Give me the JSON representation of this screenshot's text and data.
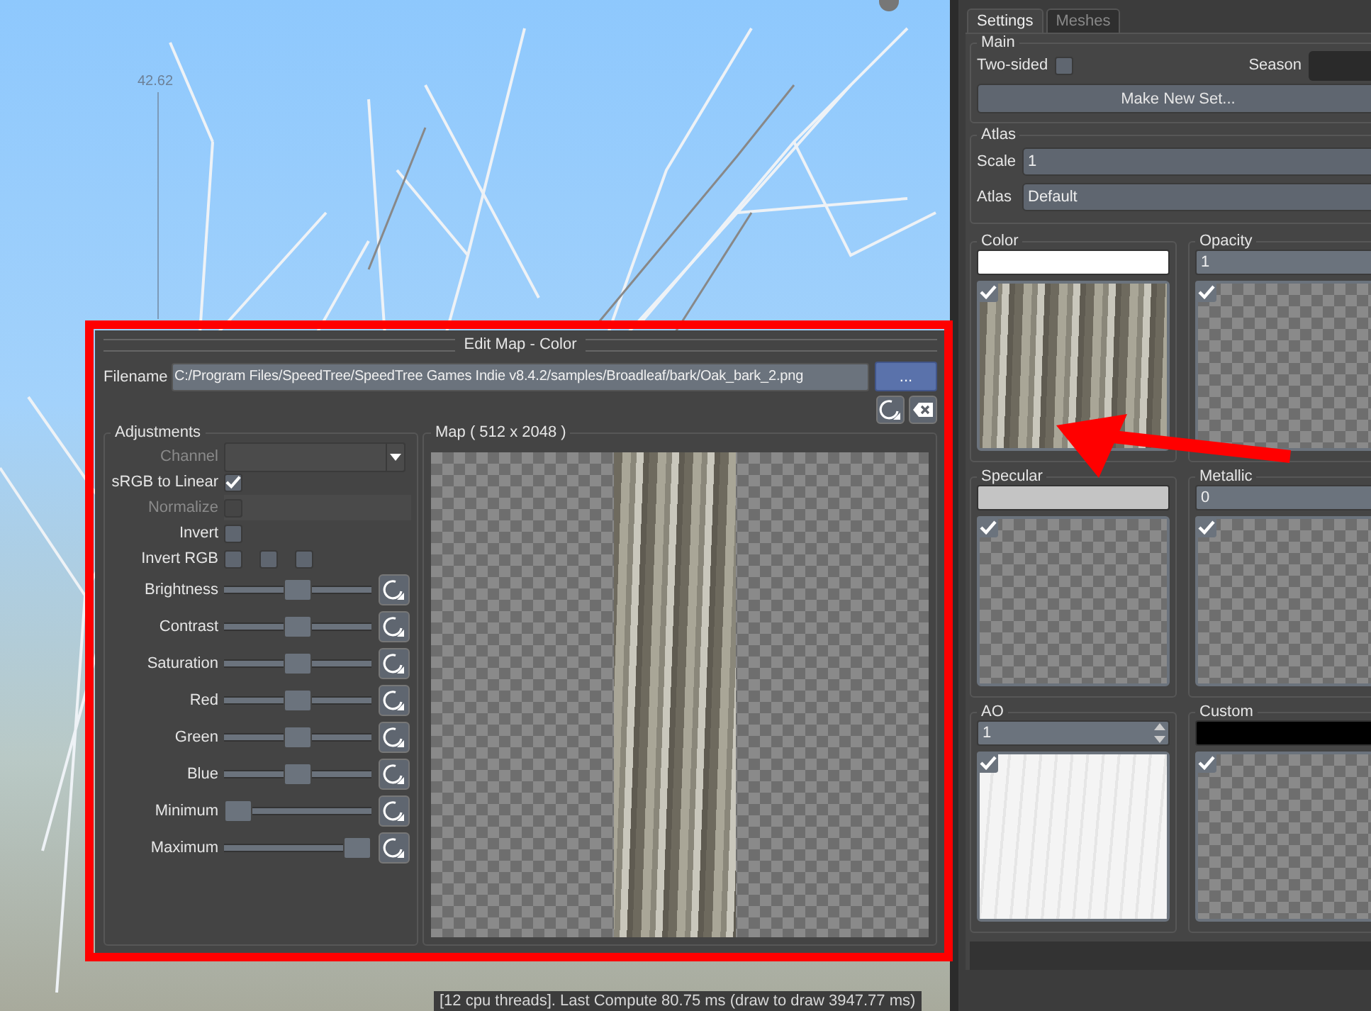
{
  "viewport": {
    "measurement": "42.62"
  },
  "dialog": {
    "title": "Edit Map - Color",
    "filename_label": "Filename",
    "filename": "C:/Program Files/SpeedTree/SpeedTree Games Indie v8.4.2/samples/Broadleaf/bark/Oak_bark_2.png",
    "browse_button": "...",
    "adjustments": {
      "title": "Adjustments",
      "channel": {
        "label": "Channel",
        "disabled": true
      },
      "checks": [
        {
          "label": "sRGB to Linear",
          "disabled": false,
          "boxes": [
            {
              "checked": true
            }
          ]
        },
        {
          "label": "Normalize",
          "disabled": true,
          "boxes": [
            {
              "checked": false
            }
          ]
        },
        {
          "label": "Invert",
          "disabled": false,
          "boxes": [
            {
              "checked": false
            }
          ]
        },
        {
          "label": "Invert RGB",
          "disabled": false,
          "boxes": [
            {
              "checked": false
            },
            {
              "checked": false
            },
            {
              "checked": false
            }
          ]
        }
      ],
      "sliders": [
        {
          "label": "Brightness",
          "level": 0.5
        },
        {
          "label": "Contrast",
          "level": 0.5
        },
        {
          "label": "Saturation",
          "level": 0.5
        },
        {
          "label": "Red",
          "level": 0.5
        },
        {
          "label": "Green",
          "level": 0.5
        },
        {
          "label": "Blue",
          "level": 0.5
        },
        {
          "label": "Minimum",
          "level": 0
        },
        {
          "label": "Maximum",
          "level": 1
        }
      ]
    },
    "map": {
      "title": "Map  ( 512 x 2048 )"
    }
  },
  "panel": {
    "tabs": [
      {
        "label": "Settings",
        "selected": true
      },
      {
        "label": "Meshes",
        "selected": false
      }
    ],
    "main": {
      "title": "Main",
      "two_sided": {
        "label": "Two-sided",
        "checked": false
      },
      "season_label": "Season",
      "make_button": "Make New Set..."
    },
    "atlas": {
      "title": "Atlas",
      "fields": [
        {
          "label": "Scale",
          "value": "1"
        },
        {
          "label": "Atlas",
          "value": "Default"
        }
      ]
    },
    "maps": [
      {
        "title": "Color",
        "input": {
          "kind": "swatch",
          "color": "#ffffff"
        },
        "checked": true,
        "preview": {
          "kind": "bark"
        }
      },
      {
        "title": "Opacity",
        "input": {
          "kind": "field",
          "value": "1"
        },
        "checked": true,
        "preview": {
          "kind": "checker"
        }
      },
      {
        "title": "Specular",
        "input": {
          "kind": "swatch",
          "color": "#c4c4c4"
        },
        "checked": true,
        "preview": {
          "kind": "checker"
        }
      },
      {
        "title": "Metallic",
        "input": {
          "kind": "field",
          "value": "0"
        },
        "checked": true,
        "preview": {
          "kind": "checker"
        }
      },
      {
        "title": "AO",
        "input": {
          "kind": "spin",
          "value": "1"
        },
        "checked": true,
        "preview": {
          "kind": "white"
        }
      },
      {
        "title": "Custom",
        "input": {
          "kind": "swatch",
          "color": "#000000"
        },
        "checked": true,
        "preview": {
          "kind": "checker"
        }
      }
    ]
  },
  "status_bar": "[12 cpu threads]. Last Compute 80.75 ms (draw to draw 3947.77 ms)"
}
